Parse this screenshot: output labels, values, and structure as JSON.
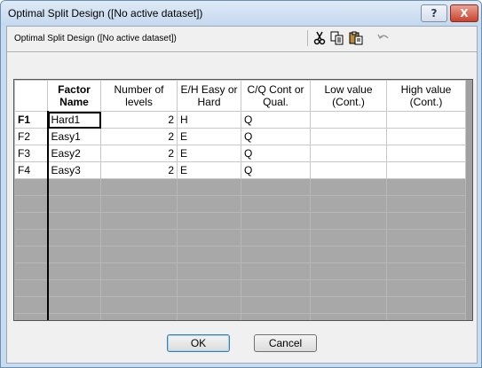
{
  "window": {
    "title": "Optimal Split Design ([No active dataset])",
    "help_label": "?",
    "close_label": "X"
  },
  "subtitle": "Optimal Split Design ([No active dataset])",
  "toolbar": {
    "icons": [
      "cut-icon",
      "copy-icon",
      "paste-icon",
      "undo-icon"
    ]
  },
  "table": {
    "headers": [
      "",
      "Factor Name",
      "Number of levels",
      "E/H Easy or Hard",
      "C/Q Cont or Qual.",
      "Low value (Cont.)",
      "High value (Cont.)"
    ],
    "rows": [
      {
        "id": "F1",
        "name": "Hard1",
        "levels": "2",
        "eh": "H",
        "cq": "Q",
        "low": "",
        "high": ""
      },
      {
        "id": "F2",
        "name": "Easy1",
        "levels": "2",
        "eh": "E",
        "cq": "Q",
        "low": "",
        "high": ""
      },
      {
        "id": "F3",
        "name": "Easy2",
        "levels": "2",
        "eh": "E",
        "cq": "Q",
        "low": "",
        "high": ""
      },
      {
        "id": "F4",
        "name": "Easy3",
        "levels": "2",
        "eh": "E",
        "cq": "Q",
        "low": "",
        "high": ""
      }
    ]
  },
  "buttons": {
    "ok": "OK",
    "cancel": "Cancel"
  }
}
